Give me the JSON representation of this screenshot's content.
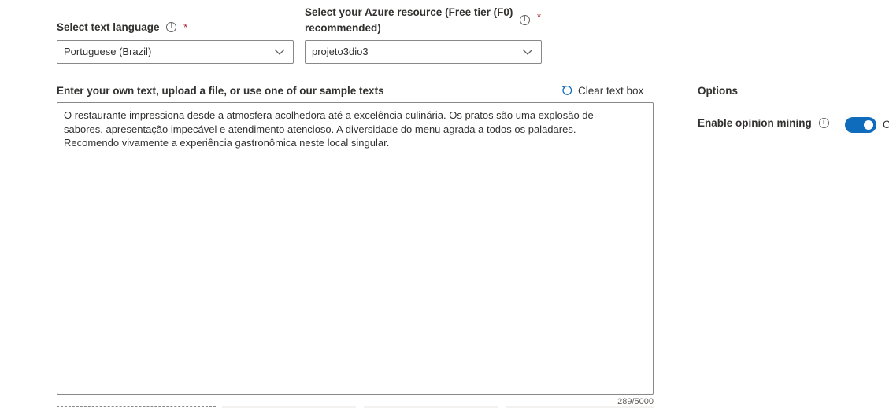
{
  "language": {
    "label": "Select text language",
    "required_mark": "*",
    "info_icon": "info-icon",
    "selected": "Portuguese (Brazil)"
  },
  "resource": {
    "label_line1": "Select your Azure resource (Free tier (F0)",
    "label_line2": "recommended)",
    "required_mark": "*",
    "info_icon": "info-icon",
    "selected": "projeto3dio3"
  },
  "text_input": {
    "label": "Enter your own text, upload a file, or use one of our sample texts",
    "clear_label": "Clear text box",
    "clear_icon": "undo-icon",
    "value": "O restaurante impressiona desde a atmosfera acolhedora até a excelência culinária. Os pratos são uma explosão de\nsabores, apresentação impecável e atendimento atencioso. A diversidade do menu agrada a todos os paladares.\nRecomendo vivamente a experiência gastronômica neste local singular.",
    "counter": "289/5000"
  },
  "options": {
    "title": "Options",
    "opinion_mining_label": "Enable opinion mining",
    "opinion_mining_enabled": true,
    "toggle_text": "C",
    "info_icon": "info-icon"
  },
  "colors": {
    "accent": "#0f6cbd",
    "required": "#a4262c",
    "border": "#8a8886"
  }
}
